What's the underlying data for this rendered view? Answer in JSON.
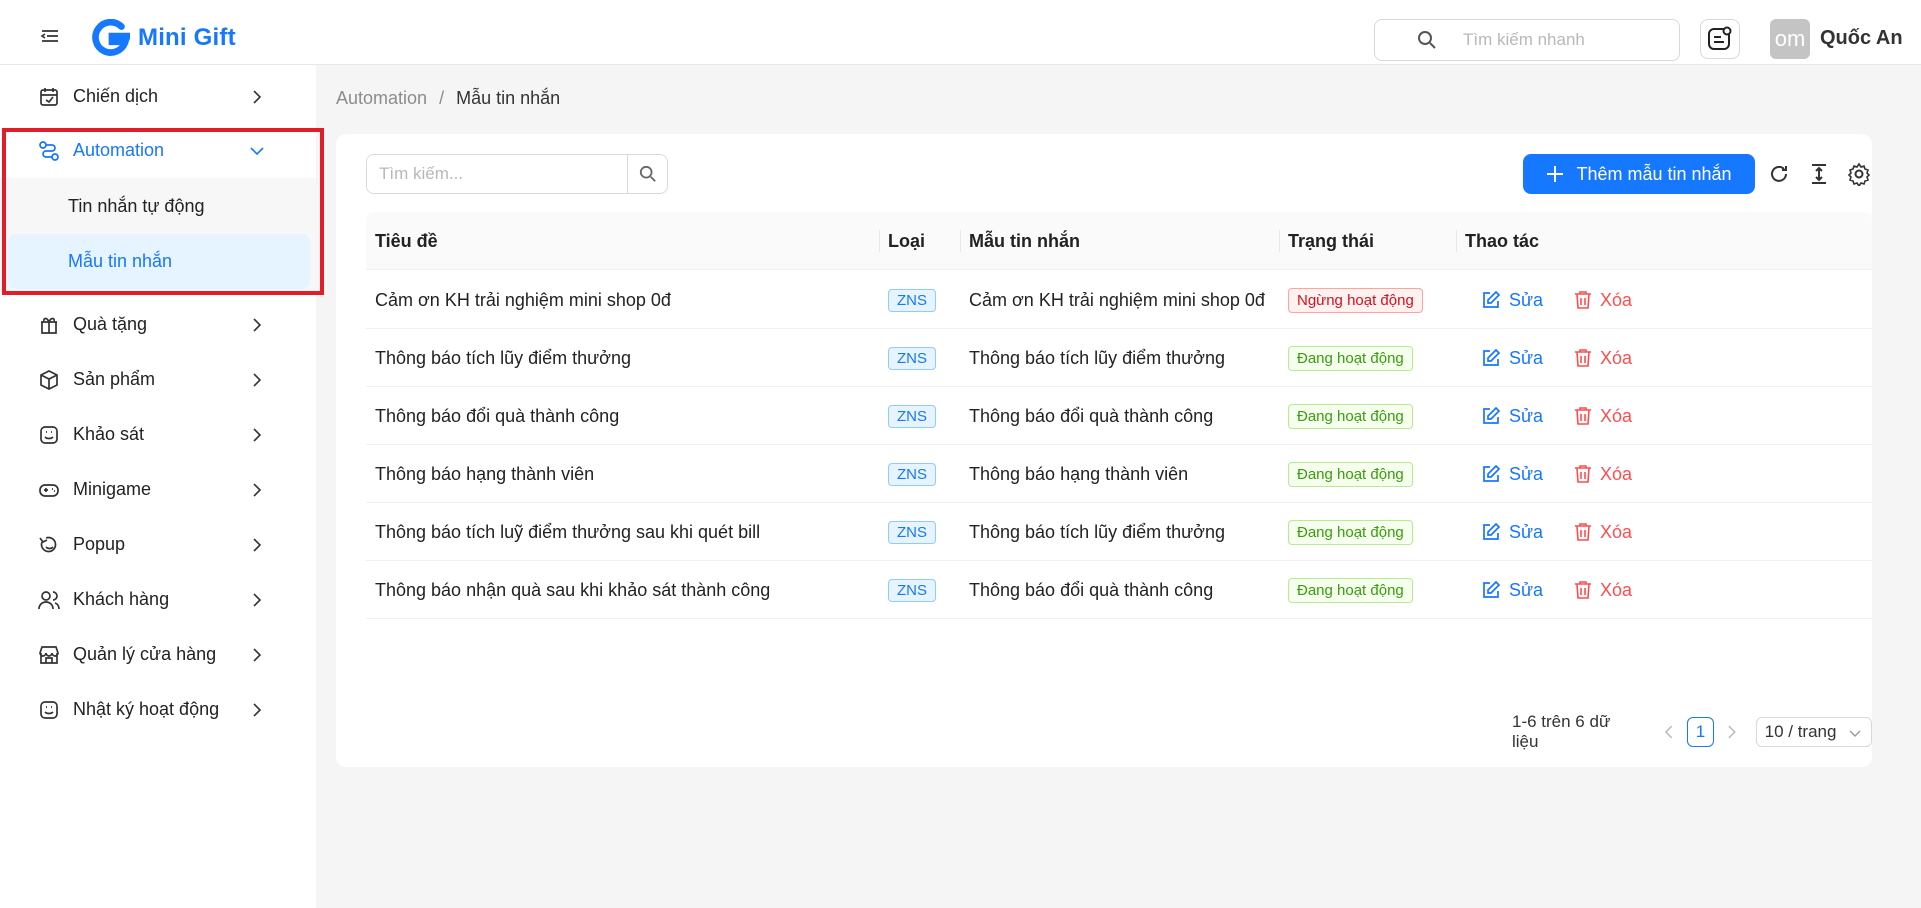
{
  "header": {
    "brand": "Mini Gift",
    "search_placeholder": "Tìm kiếm nhanh",
    "avatar_text": "om",
    "username": "Quốc An"
  },
  "sidebar": {
    "items": [
      {
        "label": "Chiến dịch",
        "icon": "campaign-icon"
      },
      {
        "label": "Automation",
        "icon": "automation-icon",
        "expanded": true
      },
      {
        "label": "Quà tặng",
        "icon": "gift-icon"
      },
      {
        "label": "Sản phẩm",
        "icon": "box-icon"
      },
      {
        "label": "Khảo sát",
        "icon": "survey-icon"
      },
      {
        "label": "Minigame",
        "icon": "gamepad-icon"
      },
      {
        "label": "Popup",
        "icon": "popup-icon"
      },
      {
        "label": "Khách hàng",
        "icon": "users-icon"
      },
      {
        "label": "Quản lý cửa hàng",
        "icon": "store-icon"
      },
      {
        "label": "Nhật ký hoạt động",
        "icon": "log-icon"
      }
    ],
    "submenu": [
      {
        "label": "Tin nhắn tự động"
      },
      {
        "label": "Mẫu tin nhắn",
        "selected": true
      }
    ]
  },
  "breadcrumb": {
    "parent": "Automation",
    "separator": "/",
    "current": "Mẫu tin nhắn"
  },
  "toolbar": {
    "search_placeholder": "Tìm kiếm...",
    "add_label": "Thêm mẫu tin nhắn"
  },
  "table": {
    "columns": [
      "Tiêu đề",
      "Loại",
      "Mẫu tin nhắn",
      "Trạng thái",
      "Thao tác"
    ],
    "edit_label": "Sửa",
    "delete_label": "Xóa",
    "rows": [
      {
        "title": "Cảm ơn KH trải nghiệm mini shop 0đ",
        "type": "ZNS",
        "template": "Cảm ơn KH trải nghiệm mini shop 0đ",
        "status": "Ngừng hoạt động",
        "active": false
      },
      {
        "title": "Thông báo tích lũy điểm thưởng",
        "type": "ZNS",
        "template": "Thông báo tích lũy điểm thưởng",
        "status": "Đang hoạt động",
        "active": true
      },
      {
        "title": "Thông báo đổi quà thành công",
        "type": "ZNS",
        "template": "Thông báo đổi quà thành công",
        "status": "Đang hoạt động",
        "active": true
      },
      {
        "title": "Thông báo hạng thành viên",
        "type": "ZNS",
        "template": "Thông báo hạng thành viên",
        "status": "Đang hoạt động",
        "active": true
      },
      {
        "title": "Thông báo tích luỹ điểm thưởng sau khi quét bill",
        "type": "ZNS",
        "template": "Thông báo tích lũy điểm thưởng",
        "status": "Đang hoạt động",
        "active": true
      },
      {
        "title": "Thông báo nhận quà sau khi khảo sát thành công",
        "type": "ZNS",
        "template": "Thông báo đổi quà thành công",
        "status": "Đang hoạt động",
        "active": true
      }
    ]
  },
  "pagination": {
    "total_text": "1-6 trên 6 dữ liệu",
    "current_page": "1",
    "page_size": "10 / trang"
  },
  "colors": {
    "primary": "#1677ff",
    "danger": "#ff4d4f",
    "success": "#389e0d",
    "highlight": "#e11d2a"
  }
}
